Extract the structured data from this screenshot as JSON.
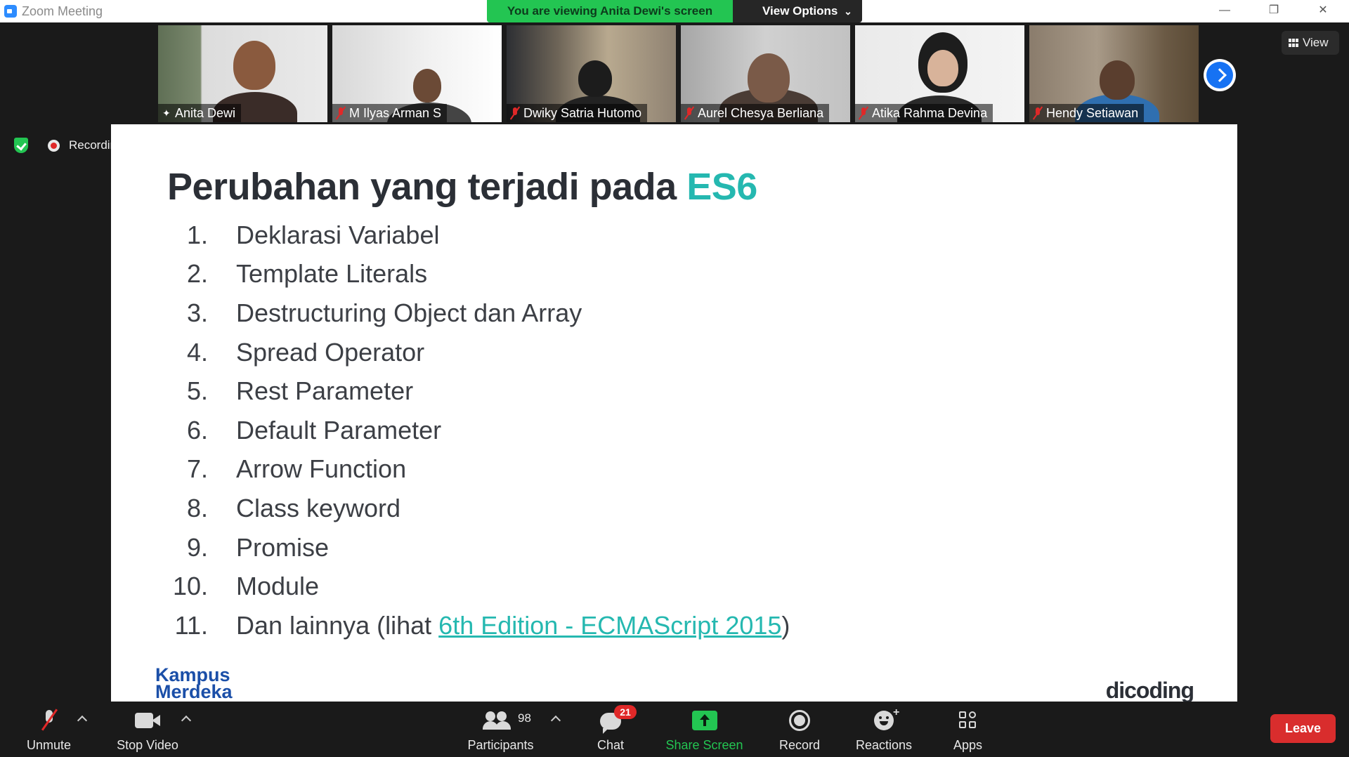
{
  "window": {
    "title": "Zoom Meeting",
    "minimize_glyph": "—",
    "restore_glyph": "❐",
    "close_glyph": "✕"
  },
  "banner": {
    "viewing_text": "You are viewing Anita Dewi's screen",
    "view_options_label": "View Options",
    "view_options_caret": "⌄"
  },
  "view_button_label": "View",
  "recording_label": "Recording",
  "gallery": {
    "participants": [
      {
        "name": "Anita Dewi",
        "icon": "pin-icon",
        "active": true
      },
      {
        "name": "M Ilyas Arman S",
        "icon": "muted-mic-icon",
        "active": false
      },
      {
        "name": "Dwiky Satria Hutomo",
        "icon": "muted-mic-icon",
        "active": false
      },
      {
        "name": "Aurel Chesya Berliana",
        "icon": "muted-mic-icon",
        "active": false
      },
      {
        "name": "Atika Rahma Devina",
        "icon": "muted-mic-icon",
        "active": false
      },
      {
        "name": "Hendy Setiawan",
        "icon": "muted-mic-icon",
        "active": false
      }
    ]
  },
  "slide": {
    "title_main": "Perubahan yang terjadi pada ",
    "title_accent": "ES6",
    "items": [
      {
        "num": "1.",
        "text": "Deklarasi Variabel"
      },
      {
        "num": "2.",
        "text": "Template Literals"
      },
      {
        "num": "3.",
        "text": "Destructuring Object dan Array"
      },
      {
        "num": "4.",
        "text": "Spread Operator"
      },
      {
        "num": "5.",
        "text": "Rest Parameter"
      },
      {
        "num": "6.",
        "text": "Default Parameter"
      },
      {
        "num": "7.",
        "text": "Arrow Function"
      },
      {
        "num": "8.",
        "text": "Class keyword"
      },
      {
        "num": "9.",
        "text": "Promise"
      },
      {
        "num": "10.",
        "text": "Module"
      }
    ],
    "last_item": {
      "num": "11.",
      "prefix": "Dan lainnya (lihat ",
      "link": "6th Edition - ECMAScript 2015",
      "suffix": ")"
    },
    "logo_left_line1": "Kampus",
    "logo_left_line2": "Merdeka",
    "logo_right": "dicoding"
  },
  "toolbar": {
    "unmute": "Unmute",
    "stop_video": "Stop Video",
    "participants": "Participants",
    "participant_count": "98",
    "chat": "Chat",
    "chat_badge": "21",
    "share_screen": "Share Screen",
    "record": "Record",
    "reactions": "Reactions",
    "apps": "Apps",
    "leave": "Leave"
  },
  "colors": {
    "accent": "#25b8b0",
    "banner_green": "#23c552",
    "leave_red": "#d92d2d",
    "muted_red": "#e02828"
  }
}
